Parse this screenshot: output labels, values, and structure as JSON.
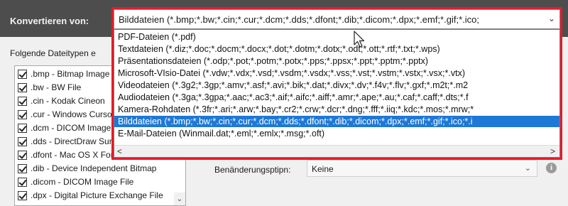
{
  "header": {
    "label": "Konvertieren von:"
  },
  "combo": {
    "value": "Bilddateien (*.bmp;*.bw;*.cin;*.cur;*.dcm;*.dds;*.dfont;*.dib;*.dicom;*.dpx;*.emf;*.gif;*.ico;"
  },
  "dropdown": {
    "items": [
      "PDF-Dateien (*.pdf)",
      "Textdateien (*.diz;*.doc;*.docm;*.docx;*.dot;*.dotm;*.dotx;*.odt;*.ott;*.rtf;*.txt;*.wps)",
      "Präsentationsdateien (*.odp;*.pot;*.potm;*.potx;*.pps;*.ppsx;*.ppt;*.pptm;*.pptx)",
      "Microsoft-VIsio-Datei (*.vdw;*.vdx;*.vsd;*.vsdm;*.vsdx;*.vss;*.vst;*.vstm;*.vstx;*.vsx;*.vtx)",
      "Videodateien (*.3g2;*.3gp;*.amv;*.asf;*.avi;*.bik;*.dat;*.divx;*.dv;*.f4v;*.flv;*.gxf;*.m2t;*.m2",
      "Audiodateien (*.3ga;*.3gpa;*.aac;*.ac3;*.aif;*.aifc;*.aiff;*.amr;*.ape;*.au;*.caf;*.caff;*.dts;*.f",
      "Kamera-Rohdaten (*.3fr;*.ari;*.arw;*.bay;*.cr2;*.crw;*.dcr;*.dng;*.fff;*.iiq;*.kdc;*.mos;*.mrw;*",
      "Bilddateien (*.bmp;*.bw;*.cin;*.cur;*.dcm;*.dds;*.dfont;*.dib;*.dicom;*.dpx;*.emf;*.gif;*.ico;*.i",
      "E-Mail-Dateien (Winmail.dat;*.eml;*.emlx;*.msg;*.oft)"
    ],
    "selected_index": 7
  },
  "left": {
    "intro": "Folgende Dateitypen e",
    "types": [
      ".bmp - Bitmap Image",
      ".bw - BW File",
      ".cin - Kodak Cineon",
      ".cur - Windows Cursor",
      ".dcm - DICOM Image",
      ".dds - DirectDraw Surface",
      ".dfont - Mac OS X Font",
      ".dib - Device Independent Bitmap",
      ".dicom - DICOM Image File",
      ".dpx - Digital Picture Exchange File"
    ]
  },
  "rename": {
    "label": "Benänderungsptipn:",
    "value": "Keine"
  },
  "icons": {
    "combo_chevron": "chevron-down-icon",
    "scroll_left": "chevron-left-icon",
    "scroll_right": "chevron-right-icon",
    "info": "info-icon",
    "cursor": "mouse-cursor-icon"
  },
  "colors": {
    "highlight": "#e51a2b",
    "selection": "#1e78d6",
    "header_bg": "#4d4d4d"
  }
}
